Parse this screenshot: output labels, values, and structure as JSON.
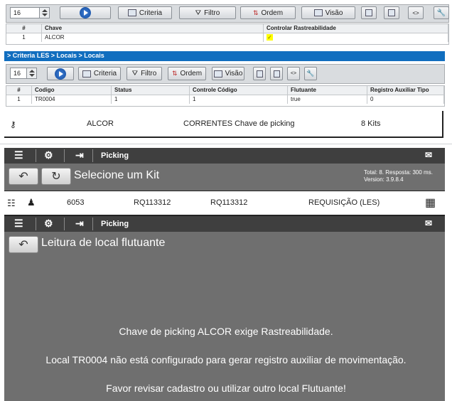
{
  "p1": {
    "page_size": "16",
    "buttons": {
      "criteria": "Criteria",
      "filtro": "Filtro",
      "ordem": "Ordem",
      "visao": "Visão"
    },
    "table": {
      "headers": [
        "#",
        "Chave",
        "Controlar Rastreabilidade"
      ],
      "rows": [
        {
          "num": "1",
          "chave": "ALCOR",
          "check": "✓"
        }
      ]
    }
  },
  "p2": {
    "breadcrumb": "> Criteria LES > Locais > Locais",
    "page_size": "16",
    "buttons": {
      "criteria": "Criteria",
      "filtro": "Filtro",
      "ordem": "Ordem",
      "visao": "Visão"
    },
    "table": {
      "headers": [
        "#",
        "Codigo",
        "Status",
        "Controle Código",
        "Flutuante",
        "Registro Auxiliar Tipo"
      ],
      "rows": [
        [
          "1",
          "TR0004",
          "1",
          "1",
          "true",
          "0"
        ]
      ]
    }
  },
  "p3": {
    "cols": [
      "ALCOR",
      "CORRENTES Chave de picking",
      "8 Kits"
    ]
  },
  "p4": {
    "title": "Picking",
    "subtitle": "Selecione um Kit",
    "total": "Total: 8. Resposta: 300 ms.",
    "version": "Version: 3.9.8.4",
    "row": [
      "6053",
      "RQ113312",
      "RQ113312",
      "REQUISIÇÃO (LES)"
    ]
  },
  "p5": {
    "title": "Picking",
    "subtitle": "Leitura de local flutuante",
    "messages": [
      "Chave de picking ALCOR exige Rastreabilidade.",
      "Local TR0004 não está configurado para gerar registro auxiliar de movimentação.",
      "Favor revisar cadastro ou utilizar outro local Flutuante!"
    ]
  },
  "colors": {
    "breadcrumb": "#116ebf",
    "mobile_bg": "#6f6f6f",
    "mobile_bar": "#3f3f3f",
    "check": "#ffff00"
  }
}
